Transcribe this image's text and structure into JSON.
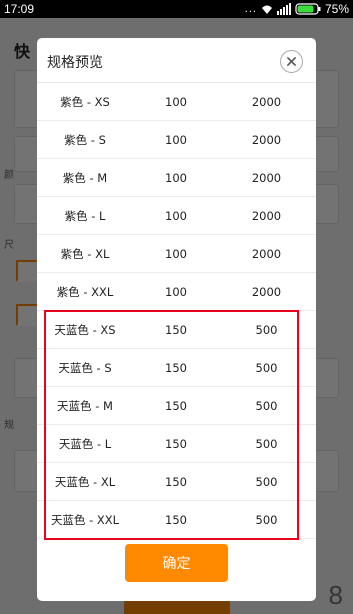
{
  "status_bar": {
    "time": "17:09",
    "dots": "...",
    "battery": "75%"
  },
  "background": {
    "title": "快",
    "label_1": "颜",
    "label_2": "尺",
    "label_3": "规",
    "digit": "8"
  },
  "dialog": {
    "title": "规格预览",
    "close_icon": "close-icon",
    "rows": [
      {
        "spec": "紫色 - XS",
        "stock": "100",
        "price": "2000"
      },
      {
        "spec": "紫色 - S",
        "stock": "100",
        "price": "2000"
      },
      {
        "spec": "紫色 - M",
        "stock": "100",
        "price": "2000"
      },
      {
        "spec": "紫色 - L",
        "stock": "100",
        "price": "2000"
      },
      {
        "spec": "紫色 - XL",
        "stock": "100",
        "price": "2000"
      },
      {
        "spec": "紫色 - XXL",
        "stock": "100",
        "price": "2000"
      },
      {
        "spec": "天蓝色 - XS",
        "stock": "150",
        "price": "500"
      },
      {
        "spec": "天蓝色 - S",
        "stock": "150",
        "price": "500"
      },
      {
        "spec": "天蓝色 - M",
        "stock": "150",
        "price": "500"
      },
      {
        "spec": "天蓝色 - L",
        "stock": "150",
        "price": "500"
      },
      {
        "spec": "天蓝色 - XL",
        "stock": "150",
        "price": "500"
      },
      {
        "spec": "天蓝色 - XXL",
        "stock": "150",
        "price": "500"
      }
    ],
    "confirm_label": "确定"
  },
  "colors": {
    "accent": "#ff8a00",
    "highlight": "#e8001c",
    "battery": "#3ddc3d"
  }
}
